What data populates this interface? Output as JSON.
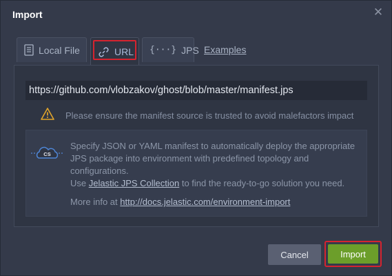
{
  "dialog": {
    "title": "Import",
    "close_icon": "close-icon"
  },
  "tabs": [
    {
      "label": "Local File",
      "icon": "file-icon"
    },
    {
      "label": "URL",
      "icon": "link-icon",
      "active": true
    },
    {
      "label": "JPS",
      "icon": "braces-icon"
    }
  ],
  "examples_link": "Examples",
  "url_input": {
    "value": "https://github.com/vlobzakov/ghost/blob/master/manifest.jps"
  },
  "warning": {
    "icon": "warning-icon",
    "text": "Please ensure the manifest source is trusted to avoid malefactors impact"
  },
  "info": {
    "icon": "cloud-cs-icon",
    "icon_label": "CS",
    "line1": "Specify JSON or YAML manifest to automatically deploy the appropriate JPS package into environment with predefined topology and configurations.",
    "line2_prefix": "Use ",
    "line2_link": "Jelastic JPS Collection",
    "line2_suffix": " to find the ready-to-go solution you need.",
    "more_prefix": "More info at ",
    "more_link": "http://docs.jelastic.com/environment-import"
  },
  "buttons": {
    "cancel": "Cancel",
    "import": "Import"
  },
  "colors": {
    "highlight": "#d6232f",
    "import_button": "#6c9e2a"
  }
}
